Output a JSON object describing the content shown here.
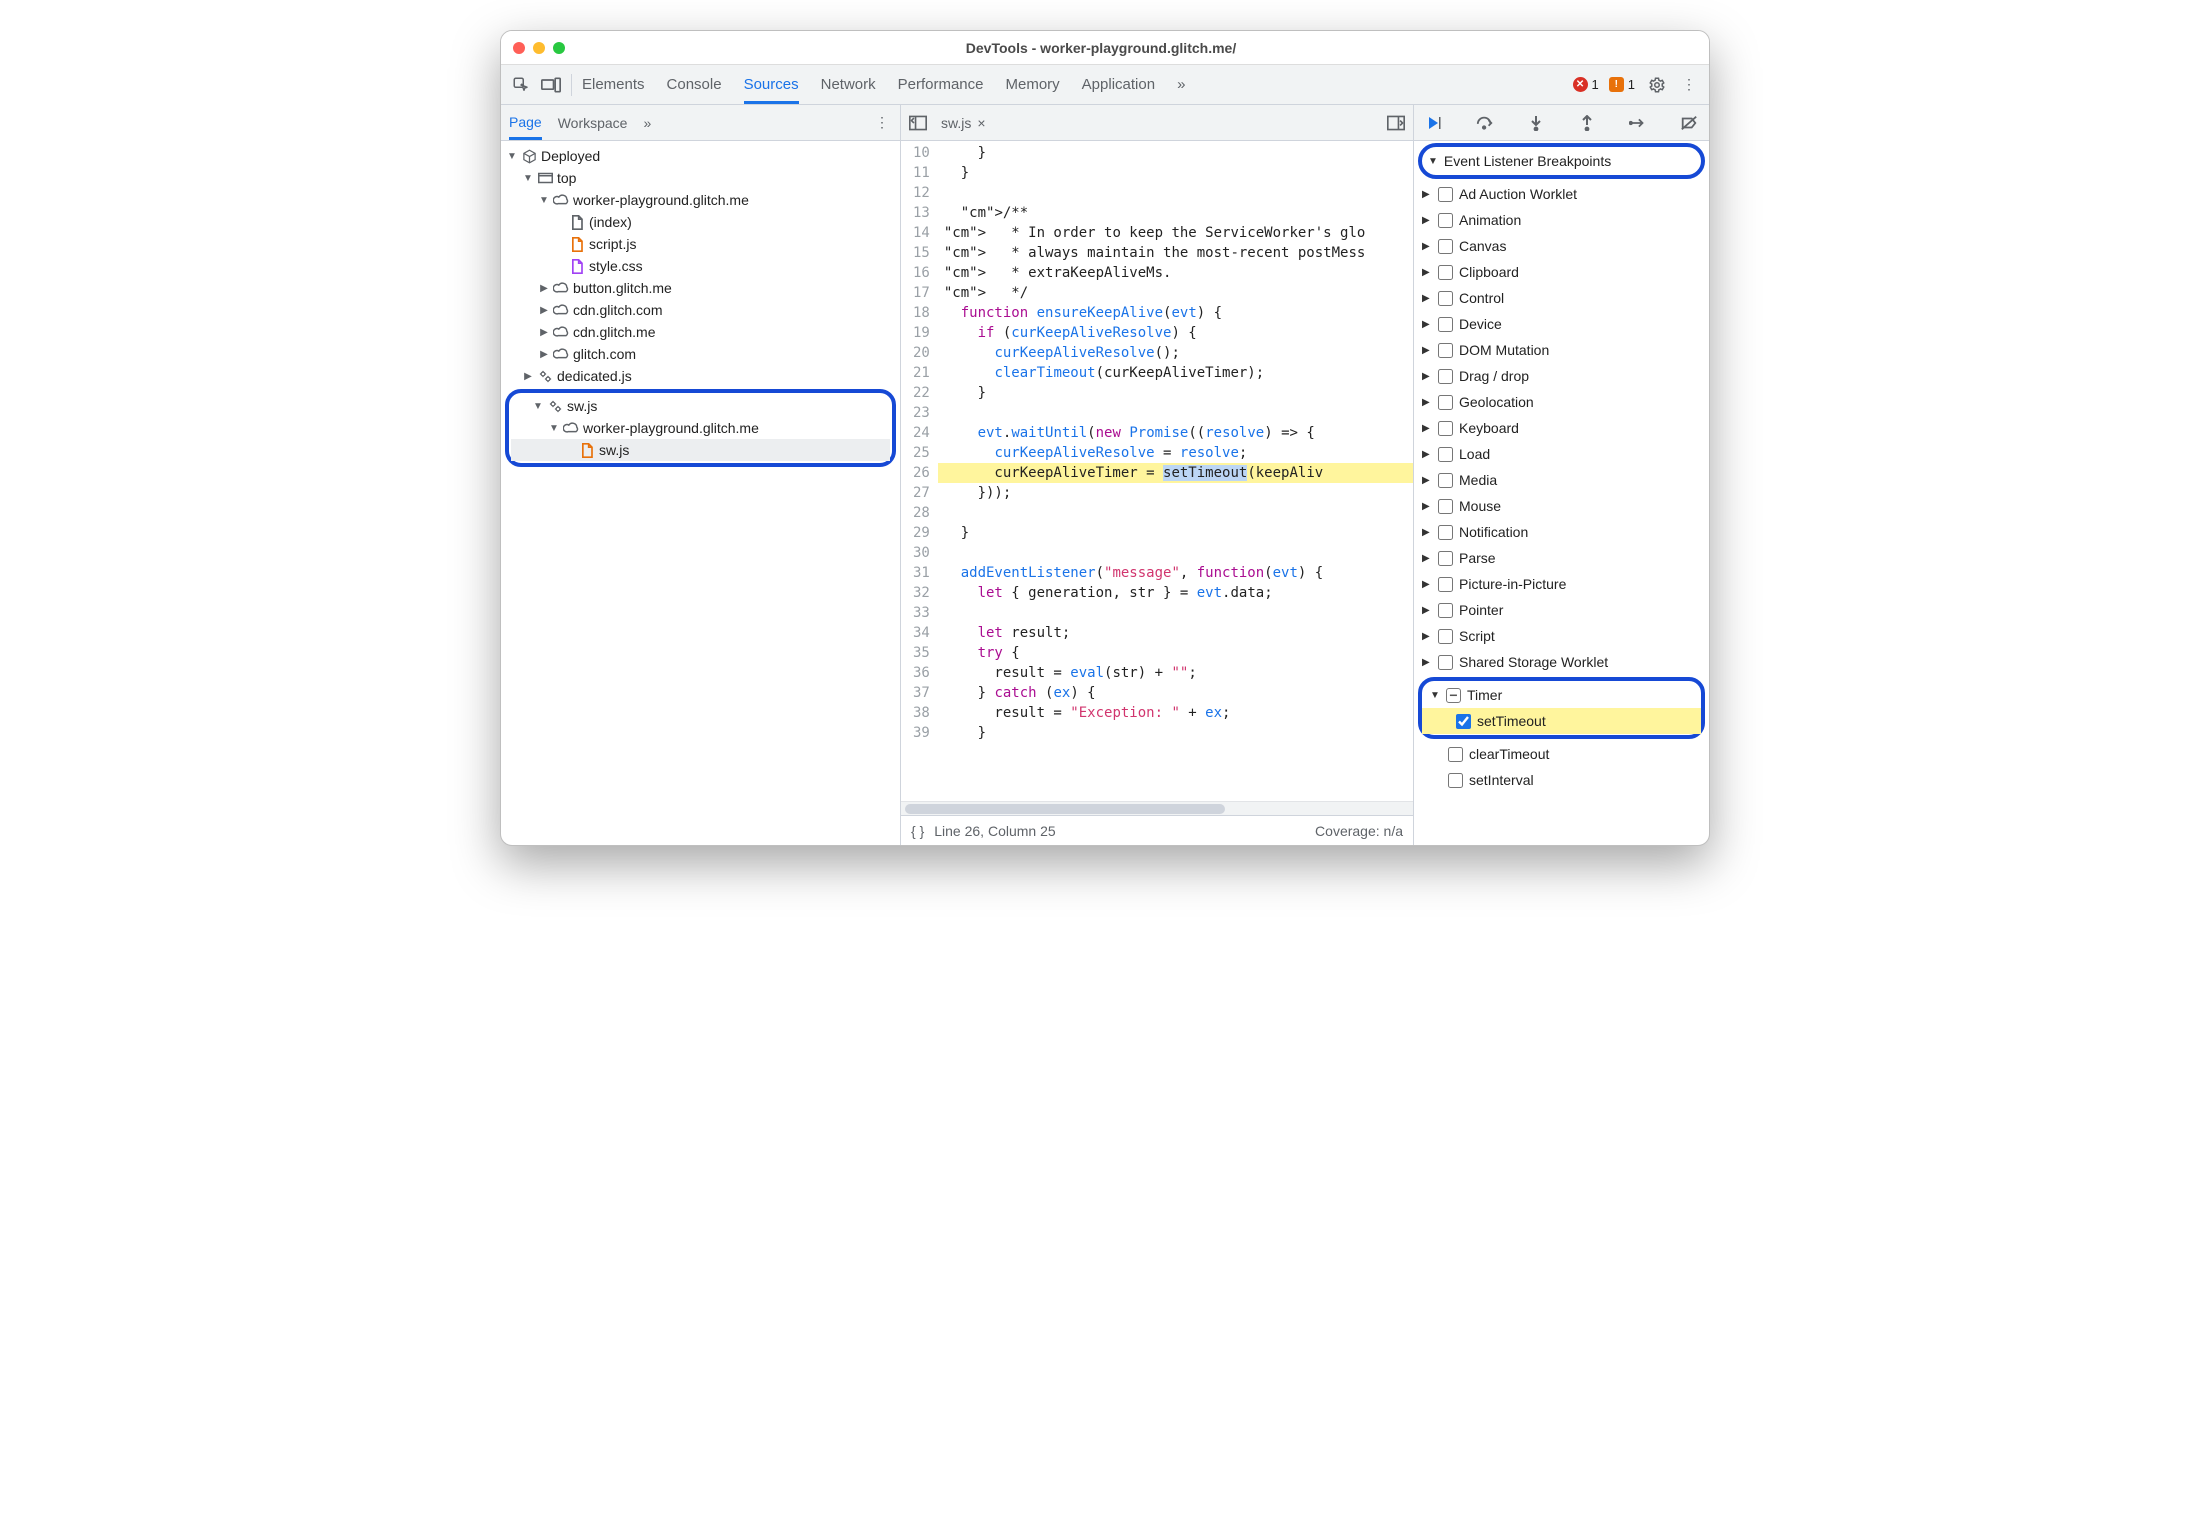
{
  "window_title": "DevTools - worker-playground.glitch.me/",
  "tabs": [
    "Elements",
    "Console",
    "Sources",
    "Network",
    "Performance",
    "Memory",
    "Application"
  ],
  "active_tab": "Sources",
  "error_count": "1",
  "warn_count": "1",
  "left": {
    "subtabs": [
      "Page",
      "Workspace"
    ],
    "active": "Page",
    "tree": {
      "deployed": "Deployed",
      "top": "top",
      "wp": "worker-playground.glitch.me",
      "index": "(index)",
      "script": "script.js",
      "style": "style.css",
      "button": "button.glitch.me",
      "cdn1": "cdn.glitch.com",
      "cdn2": "cdn.glitch.me",
      "glitch": "glitch.com",
      "dedicated": "dedicated.js",
      "swgroup": "sw.js",
      "wp2": "worker-playground.glitch.me",
      "swfile": "sw.js"
    }
  },
  "file_tab": "sw.js",
  "code": {
    "start": 10,
    "lines": [
      "    }",
      "  }",
      "",
      "  /**",
      "   * In order to keep the ServiceWorker's glo",
      "   * always maintain the most-recent postMess",
      "   * extraKeepAliveMs.",
      "   */",
      "  function ensureKeepAlive(evt) {",
      "    if (curKeepAliveResolve) {",
      "      curKeepAliveResolve();",
      "      clearTimeout(curKeepAliveTimer);",
      "    }",
      "",
      "    evt.waitUntil(new Promise((resolve) => {",
      "      curKeepAliveResolve = resolve;",
      "      curKeepAliveTimer = setTimeout(keepAliv",
      "    }));",
      "",
      "  }",
      "",
      "  addEventListener(\"message\", function(evt) {",
      "    let { generation, str } = evt.data;",
      "",
      "    let result;",
      "    try {",
      "      result = eval(str) + \"\";",
      "    } catch (ex) {",
      "      result = \"Exception: \" + ex;",
      "    }"
    ]
  },
  "status": {
    "pos": "Line 26, Column 25",
    "coverage": "Coverage: n/a"
  },
  "breakpoints": {
    "title": "Event Listener Breakpoints",
    "groups": [
      "Ad Auction Worklet",
      "Animation",
      "Canvas",
      "Clipboard",
      "Control",
      "Device",
      "DOM Mutation",
      "Drag / drop",
      "Geolocation",
      "Keyboard",
      "Load",
      "Media",
      "Mouse",
      "Notification",
      "Parse",
      "Picture-in-Picture",
      "Pointer",
      "Script",
      "Shared Storage Worklet"
    ],
    "timer": {
      "label": "Timer",
      "items": [
        "setTimeout",
        "clearTimeout",
        "setInterval"
      ],
      "checked": "setTimeout"
    }
  }
}
